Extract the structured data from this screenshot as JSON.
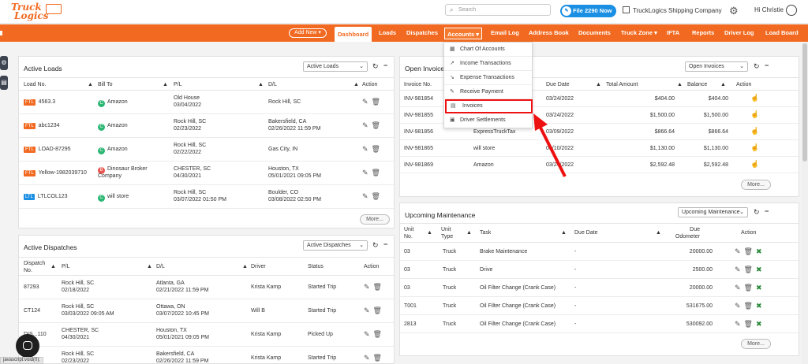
{
  "app": {
    "logo_line1": "Truck",
    "logo_line2": "Logics",
    "search_placeholder": "Search",
    "file2290_label": "File 2290 Now",
    "company_name": "TruckLogics Shipping Company",
    "greeting": "Hi Christie"
  },
  "nav": {
    "add_new": "Add New",
    "items": [
      "Dashboard",
      "Loads",
      "Dispatches",
      "Accounts",
      "Email Log",
      "Address Book",
      "Documents",
      "Truck Zone",
      "IFTA",
      "Reports",
      "Driver Log",
      "Load Board"
    ],
    "accounts_menu": [
      "Chart Of Accounts",
      "Income Transactions",
      "Expense Transactions",
      "Receive Payment",
      "Invoices",
      "Driver Settlements"
    ],
    "highlighted_menu_item": "Invoices"
  },
  "active_loads": {
    "title": "Active Loads",
    "select": "Active Loads",
    "headers": [
      "Load No.",
      "Bill To",
      "P/L",
      "D/L",
      "Action"
    ],
    "rows": [
      {
        "badge": "FTL",
        "load": "4563.3",
        "bill_initial": "C",
        "bill": "Amazon",
        "pl1": "Old House",
        "pl2": "03/04/2022",
        "dl1": "Rock Hill, SC",
        "dl2": ""
      },
      {
        "badge": "FTL",
        "load": "abc1234",
        "bill_initial": "C",
        "bill": "Amazon",
        "pl1": "Rock Hill, SC",
        "pl2": "02/23/2022",
        "dl1": "Bakersfield, CA",
        "dl2": "02/26/2022 11:59 PM"
      },
      {
        "badge": "FTL",
        "load": "LOAD-87295",
        "bill_initial": "C",
        "bill": "Amazon",
        "pl1": "Rock Hill, SC",
        "pl2": "02/22/2022",
        "dl1": "Gas City, IN",
        "dl2": ""
      },
      {
        "badge": "FTL",
        "load": "Yellow-1982039710",
        "bill_initial": "B",
        "bill": "Dinosaur Broker",
        "bill2": "Company",
        "pl1": "CHESTER, SC",
        "pl2": "04/30/2021",
        "dl1": "Houston, TX",
        "dl2": "05/01/2021 09:05 PM"
      },
      {
        "badge": "LTL",
        "load": "LTLCOL123",
        "bill_initial": "C",
        "bill": "will store",
        "pl1": "Rock Hill, SC",
        "pl2": "03/07/2022 01:50 PM",
        "dl1": "Boulder, CO",
        "dl2": "03/08/2022 02:50 PM"
      }
    ],
    "more": "More..."
  },
  "active_dispatches": {
    "title": "Active Dispatches",
    "select": "Active Dispatches",
    "headers": [
      "Dispatch No.",
      "P/L",
      "D/L",
      "Driver",
      "Status",
      "Action"
    ],
    "rows": [
      {
        "no": "87293",
        "pl1": "Rock Hill, SC",
        "pl2": "02/18/2022",
        "dl1": "Atlanta, GA",
        "dl2": "02/21/2022 11:59 PM",
        "driver": "Krista Kamp",
        "status": "Started Trip"
      },
      {
        "no": "CT124",
        "pl1": "Rock Hill, SC",
        "pl2": "03/03/2022 09:05 AM",
        "dl1": "Ottawa, ON",
        "dl2": "03/07/2022 10:45 PM",
        "driver": "Will B",
        "status": "Started Trip"
      },
      {
        "no": "DIS...110",
        "pl1": "CHESTER, SC",
        "pl2": "04/30/2021",
        "dl1": "Houston, TX",
        "dl2": "05/01/2021 09:05 PM",
        "driver": "Krista Kamp",
        "status": "Picked Up"
      },
      {
        "no": "",
        "pl1": "Rock Hill, SC",
        "pl2": "02/23/2022",
        "dl1": "Bakersfield, CA",
        "dl2": "02/26/2022 11:59 PM",
        "driver": "Krista Kamp",
        "status": "Started Trip"
      }
    ]
  },
  "open_invoices": {
    "title": "Open Invoices",
    "select": "Open Invoices",
    "headers": [
      "Invoice No.",
      "Due Date",
      "Total Amount",
      "Balance",
      "Action"
    ],
    "rows": [
      {
        "no": "INV-981854",
        "cust": "",
        "due": "03/24/2022",
        "total": "$404.00",
        "balance": "$404.00"
      },
      {
        "no": "INV-981855",
        "cust": "",
        "due": "03/24/2022",
        "total": "$1,500.00",
        "balance": "$1,500.00"
      },
      {
        "no": "INV-981856",
        "cust": "ExpressTruckTax",
        "due": "03/09/2022",
        "total": "$866.64",
        "balance": "$866.64"
      },
      {
        "no": "INV-981865",
        "cust": "will store",
        "due": "03/10/2022",
        "total": "$1,130.00",
        "balance": "$1,130.00"
      },
      {
        "no": "INV-981869",
        "cust": "Amazon",
        "due": "03/24/2022",
        "total": "$2,592.48",
        "balance": "$2,592.48"
      }
    ],
    "more": "More..."
  },
  "maintenance": {
    "title": "Upcoming Maintenance",
    "select": "Upcoming Maintenance",
    "headers": [
      "Unit No.",
      "Unit Type",
      "Task",
      "Due Date",
      "Due Odometer",
      "Action"
    ],
    "rows": [
      {
        "unit": "03",
        "type": "Truck",
        "task": "Brake Maintenance",
        "due": "-",
        "odo": "20000.00"
      },
      {
        "unit": "03",
        "type": "Truck",
        "task": "Drive",
        "due": "-",
        "odo": "2500.00"
      },
      {
        "unit": "03",
        "type": "Truck",
        "task": "Oil Filter Change (Crank Case)",
        "due": "-",
        "odo": "20000.00"
      },
      {
        "unit": "T001",
        "type": "Truck",
        "task": "Oil Filter Change (Crank Case)",
        "due": "-",
        "odo": "531675.00"
      },
      {
        "unit": "2813",
        "type": "Truck",
        "task": "Oil Filter Change (Crank Case)",
        "due": "-",
        "odo": "530092.00"
      }
    ],
    "more": "More..."
  },
  "status_bar": "javascript:void(0);",
  "colors": {
    "brand": "#f26a21",
    "ftl": "#f26a21",
    "ltl": "#1a8fe3",
    "customer": "#2bb673",
    "broker": "#e8544e",
    "highlight": "#e11111"
  }
}
